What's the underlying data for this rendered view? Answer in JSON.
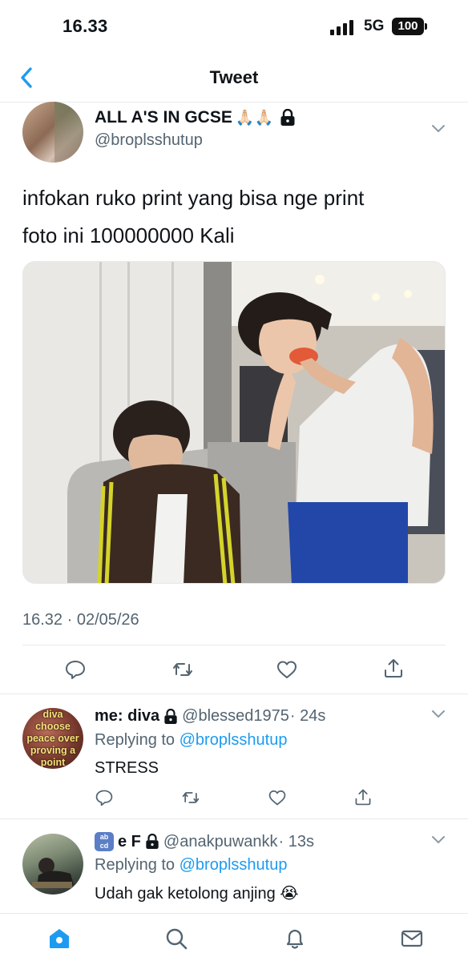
{
  "status_bar": {
    "time": "16.33",
    "network": "5G",
    "battery": "100"
  },
  "nav": {
    "title": "Tweet"
  },
  "tweet": {
    "display_name": "ALL A'S IN GCSE",
    "name_emoji": "🙏🏻🙏🏻",
    "handle": "@broplsshutup",
    "text_line1": "infokan ruko print yang bisa nge print",
    "text_line2": "foto ini 100000000 Kali",
    "timestamp": "16.32 · 02/05/26"
  },
  "replies": [
    {
      "display_name": "me: diva",
      "handle": "@blessed1975",
      "time": "· 24s",
      "replying_prefix": "Replying to ",
      "replying_to": "@broplsshutup",
      "text": "STRESS",
      "avatar_text": [
        "diva",
        "choose",
        "peace over",
        "proving a",
        "point"
      ]
    },
    {
      "name_badge": "🔤",
      "display_name": "e F",
      "handle": "@anakpuwankk",
      "time": "· 13s",
      "replying_prefix": "Replying to ",
      "replying_to": "@broplsshutup",
      "text": "Udah gak ketolong anjing 😭"
    }
  ],
  "icons": {
    "reply": "reply-icon",
    "retweet": "retweet-icon",
    "like": "like-icon",
    "share": "share-icon",
    "home": "home-icon",
    "search": "search-icon",
    "notifications": "bell-icon",
    "messages": "mail-icon"
  },
  "colors": {
    "accent": "#1d9bf0",
    "secondary_text": "#536471",
    "primary_text": "#0f1419",
    "divider": "#e6e9ec"
  }
}
